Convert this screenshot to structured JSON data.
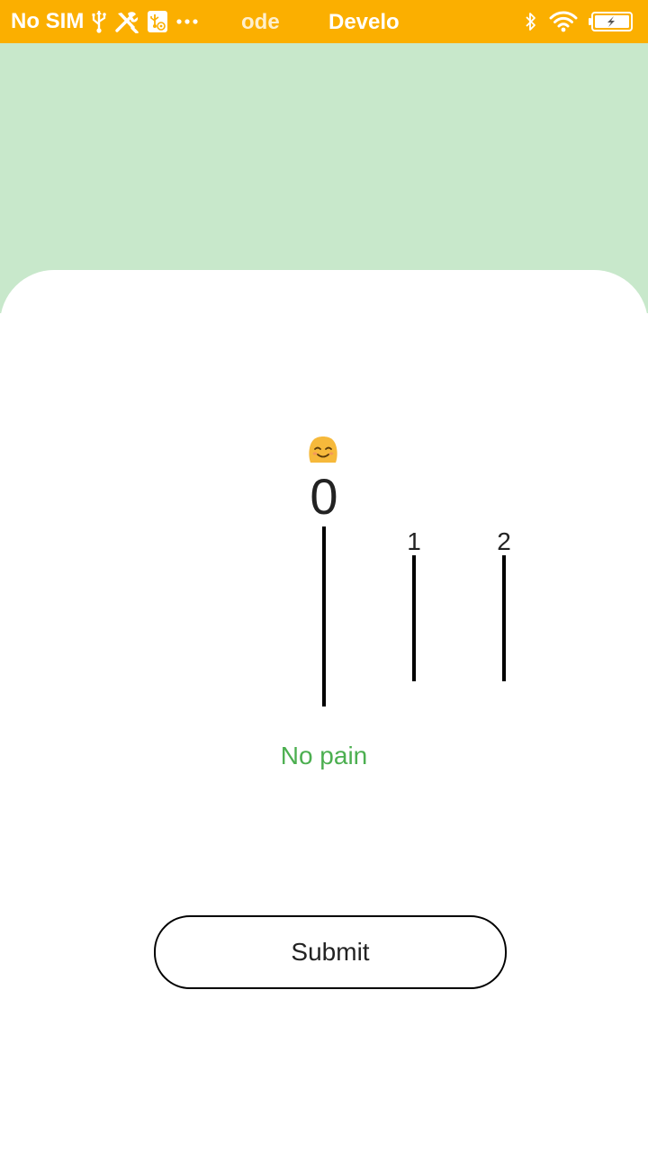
{
  "status_bar": {
    "carrier": "No SIM",
    "ticker_text_1": "ode",
    "ticker_text_2": "Develo",
    "icons": [
      "usb-icon",
      "tools-icon",
      "usb-debug-icon",
      "more-dots-icon",
      "bluetooth-icon",
      "wifi-icon",
      "battery-charging-icon"
    ],
    "background": "#FBAF00"
  },
  "header": {
    "background": "#C8E8CB"
  },
  "pain_scale": {
    "selected_value": "0",
    "selected_emoji_icon": "smiling-face-icon",
    "ticks": [
      {
        "label": "0",
        "selected": true
      },
      {
        "label": "1",
        "selected": false
      },
      {
        "label": "2",
        "selected": false
      }
    ],
    "description": "No pain",
    "description_color": "#4CAF50"
  },
  "actions": {
    "submit_label": "Submit"
  }
}
